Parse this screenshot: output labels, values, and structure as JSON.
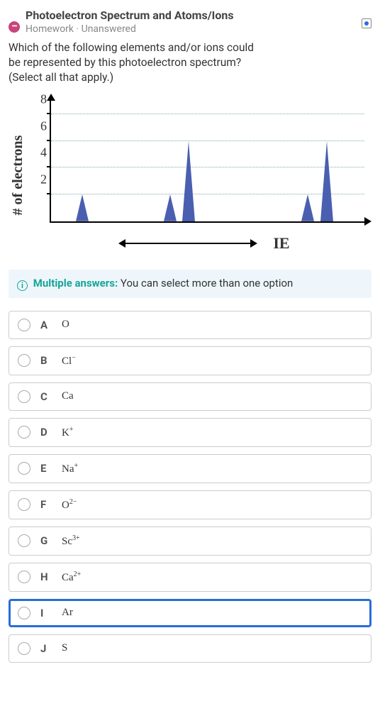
{
  "header": {
    "icon_label": "•••",
    "title": "Photoelectron Spectrum and Atoms/Ions",
    "subtitle": "Homework · Unanswered"
  },
  "question": "Which of the following elements and/or ions could be represented by this photoelectron spectrum? (Select all that apply.)",
  "chart_data": {
    "type": "line",
    "ylabel": "# of electrons",
    "xlabel": "IE",
    "y_ticks": [
      2,
      4,
      6,
      8
    ],
    "ylim": [
      0,
      9
    ],
    "peaks": [
      {
        "x_rel": 0.1,
        "height": 2
      },
      {
        "x_rel": 0.38,
        "height": 2
      },
      {
        "x_rel": 0.44,
        "height": 6
      },
      {
        "x_rel": 0.82,
        "height": 2
      },
      {
        "x_rel": 0.88,
        "height": 6
      }
    ],
    "x_axis_label": "IE"
  },
  "hint": {
    "strong": "Multiple answers:",
    "rest": " You can select more than one option"
  },
  "options": [
    {
      "letter": "A",
      "formula_html": "O",
      "focused": false
    },
    {
      "letter": "B",
      "formula_html": "Cl<sup>−</sup>",
      "focused": false
    },
    {
      "letter": "C",
      "formula_html": "Ca",
      "focused": false
    },
    {
      "letter": "D",
      "formula_html": "K<sup>+</sup>",
      "focused": false
    },
    {
      "letter": "E",
      "formula_html": "Na<sup>+</sup>",
      "focused": false
    },
    {
      "letter": "F",
      "formula_html": "O<sup>2−</sup>",
      "focused": false
    },
    {
      "letter": "G",
      "formula_html": "Sc<sup>3+</sup>",
      "focused": false
    },
    {
      "letter": "H",
      "formula_html": "Ca<sup>2+</sup>",
      "focused": false
    },
    {
      "letter": "I",
      "formula_html": "Ar",
      "focused": true
    },
    {
      "letter": "J",
      "formula_html": "S",
      "focused": false
    }
  ]
}
